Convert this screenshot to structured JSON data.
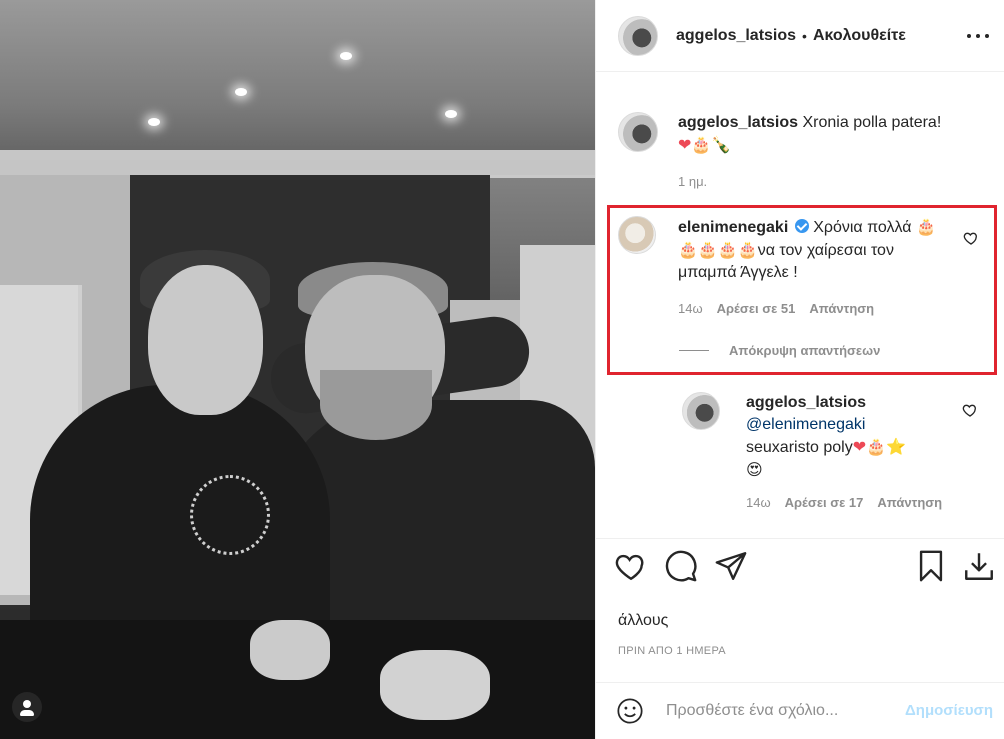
{
  "post": {
    "username": "aggelos_latsios",
    "follow_dot": "•",
    "follow_label": "Ακολουθείτε"
  },
  "caption": {
    "username": "aggelos_latsios",
    "text": "Xronia polla patera!",
    "emoji": "❤🎂🍾",
    "time": "1 ημ."
  },
  "highlighted_comment": {
    "username": "elenimenegaki",
    "text_part1": "Χρόνια πολλά",
    "cakes": "🎂🎂🎂🎂🎂",
    "text_part2": "να τον χαίρεσαι τον μπαμπά Άγγελε !",
    "time": "14ω",
    "likes": "Αρέσει σε 51",
    "reply": "Απάντηση",
    "hide_replies": "Απόκρυψη απαντήσεων",
    "highlight_color": "#e0242e"
  },
  "reply": {
    "username": "aggelos_latsios",
    "mention": "@elenimenegaki",
    "text": "seuxaristo poly",
    "emoji": "❤🎂⭐",
    "emoji2": "😍",
    "time": "14ω",
    "likes": "Αρέσει σε 17",
    "reply": "Απάντηση"
  },
  "bottom": {
    "truncated_text": "άλλους",
    "date": "ΠΡΙΝ ΑΠΟ 1 ΗΜΕΡΑ",
    "comment_placeholder": "Προσθέστε ένα σχόλιο...",
    "publish_label": "Δημοσίευση"
  },
  "colors": {
    "text": "#262626",
    "muted": "#8e8e8e",
    "link": "#003569",
    "verified": "#3897f0",
    "publish_disabled": "#b2dffc"
  }
}
